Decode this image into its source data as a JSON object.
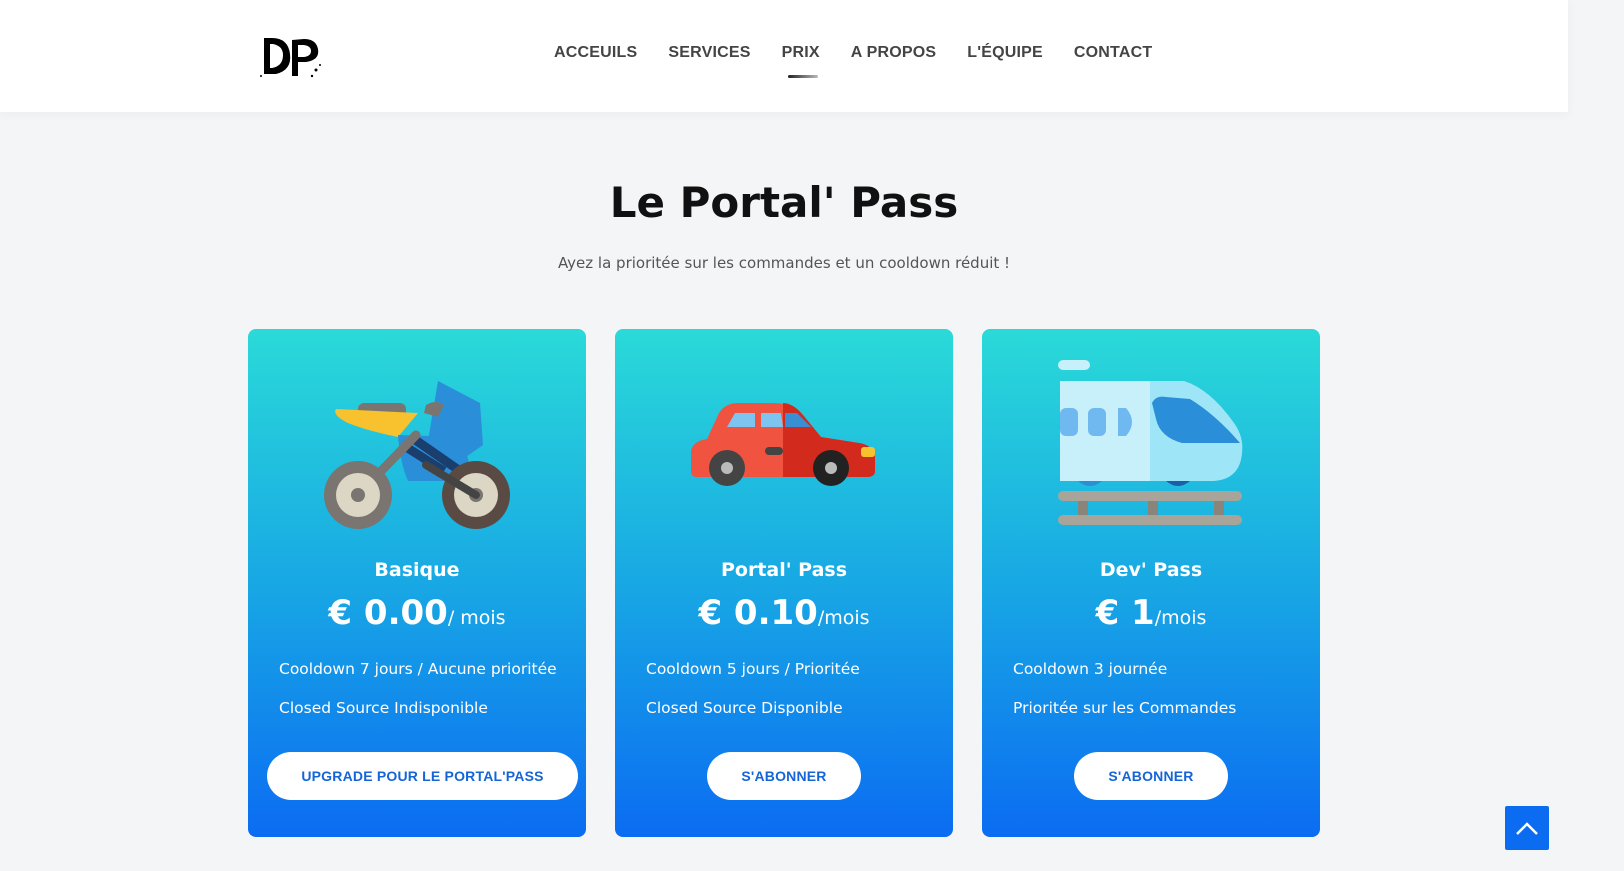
{
  "header": {
    "logo_text": "DP",
    "nav": [
      {
        "label": "ACCEUILS",
        "active": false
      },
      {
        "label": "SERVICES",
        "active": false
      },
      {
        "label": "PRIX",
        "active": true
      },
      {
        "label": "A PROPOS",
        "active": false
      },
      {
        "label": "L'ÉQUIPE",
        "active": false
      },
      {
        "label": "CONTACT",
        "active": false
      }
    ]
  },
  "pricing": {
    "title": "Le Portal' Pass",
    "subtitle": "Ayez la prioritée sur les commandes et un cooldown réduit !",
    "plans": [
      {
        "name": "Basique",
        "icon": "motorcycle-icon",
        "price": "€ 0.00",
        "period": "/ mois",
        "features": [
          "Cooldown 7 jours / Aucune prioritée",
          "Closed Source Indisponible"
        ],
        "button": "UPGRADE POUR LE PORTAL'PASS"
      },
      {
        "name": "Portal' Pass",
        "icon": "car-icon",
        "price": "€ 0.10",
        "period": "/mois",
        "features": [
          "Cooldown 5 jours / Prioritée",
          "Closed Source Disponible"
        ],
        "button": "S'ABONNER"
      },
      {
        "name": "Dev' Pass",
        "icon": "train-icon",
        "price": "€ 1",
        "period": "/mois",
        "features": [
          "Cooldown 3 journée",
          "Prioritée sur les Commandes"
        ],
        "button": "S'ABONNER"
      }
    ]
  },
  "colors": {
    "gradient_top": "#2adad8",
    "gradient_bottom": "#0b6cf2",
    "button_text": "#1565d8",
    "back_to_top": "#0b6cf2"
  }
}
